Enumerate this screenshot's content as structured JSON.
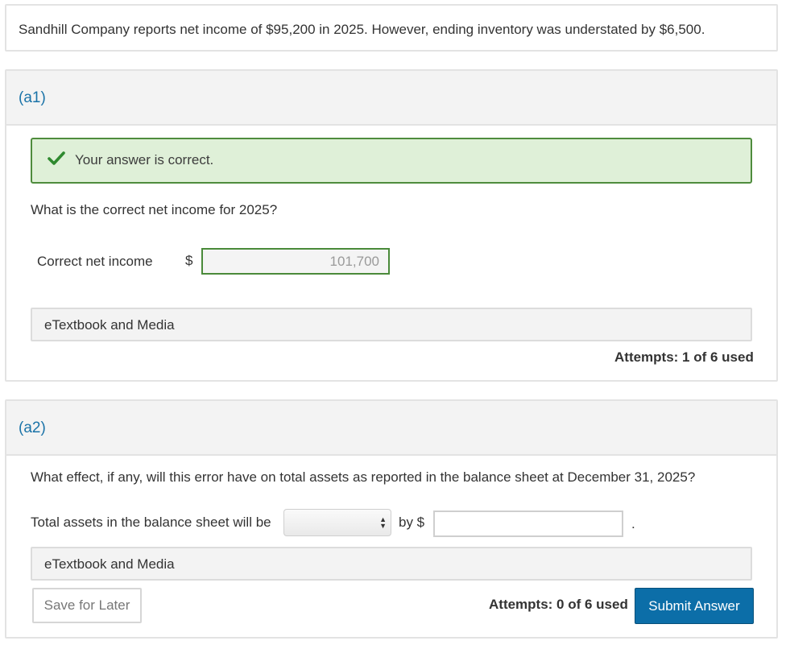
{
  "problem": {
    "text": "Sandhill Company reports net income of $95,200 in 2025. However, ending inventory was understated by $6,500."
  },
  "part_a1": {
    "label": "(a1)",
    "feedback": "Your answer is correct.",
    "feedback_icon": "checkmark-icon",
    "question": "What is the correct net income for 2025?",
    "field_label": "Correct net income",
    "currency": "$",
    "answer_value": "101,700",
    "etextbook_label": "eTextbook and Media",
    "attempts": "Attempts: 1 of 6 used"
  },
  "part_a2": {
    "label": "(a2)",
    "question": "What effect, if any, will this error have on total assets as reported in the balance sheet at December 31, 2025?",
    "field_label": "Total assets in the balance sheet will be",
    "select_value": "",
    "by_label": "by $",
    "amount_value": "",
    "period": ".",
    "etextbook_label": "eTextbook and Media",
    "save_label": "Save for Later",
    "attempts": "Attempts: 0 of 6 used",
    "submit_label": "Submit Answer"
  },
  "colors": {
    "accent_blue": "#1a73a8",
    "submit_blue": "#0c6ea8",
    "success_bg": "#dff0d8",
    "success_border": "#4f8c3d"
  }
}
